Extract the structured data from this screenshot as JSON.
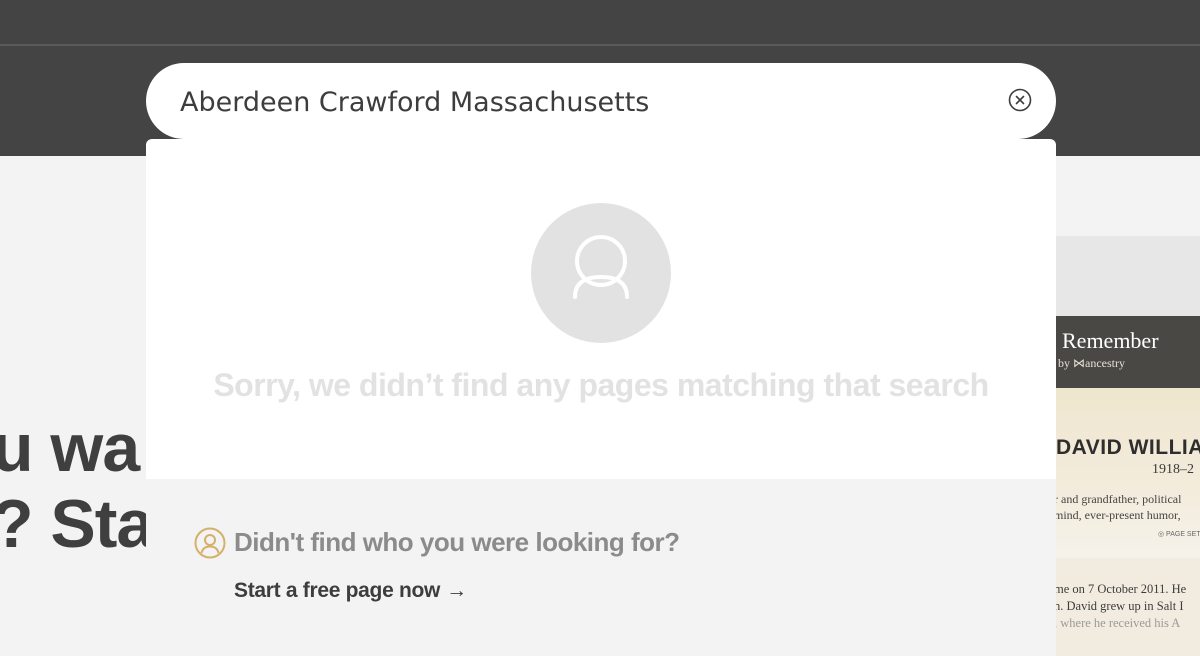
{
  "search": {
    "value": "Aberdeen Crawford Massachusetts",
    "clear_icon": "close-circle-icon"
  },
  "results": {
    "empty_icon": "person-icon",
    "empty_message": "Sorry, we didn’t find any pages matching that search"
  },
  "footer": {
    "icon": "person-circle-icon",
    "icon_color": "#d4b06a",
    "title": "Didn't find who you were looking for?",
    "link_label": "Start a free page now",
    "link_arrow": "→"
  },
  "background": {
    "hero_line1": "u wa",
    "hero_line2": "? Sta"
  },
  "preview_card": {
    "brand": "Remember",
    "brand_sub": "by ⋈ancestry",
    "name": "DAVID WILLIA",
    "years": "1918–2",
    "bio_line1": "r and grandfather, political",
    "bio_line2": "mind, ever-present humor,",
    "settings_label": "◎ PAGE SETT",
    "text_line1": "me on 7 October 2011. He",
    "text_line2": "n. David grew up in Salt I",
    "text_line3": ", where he received his A"
  }
}
